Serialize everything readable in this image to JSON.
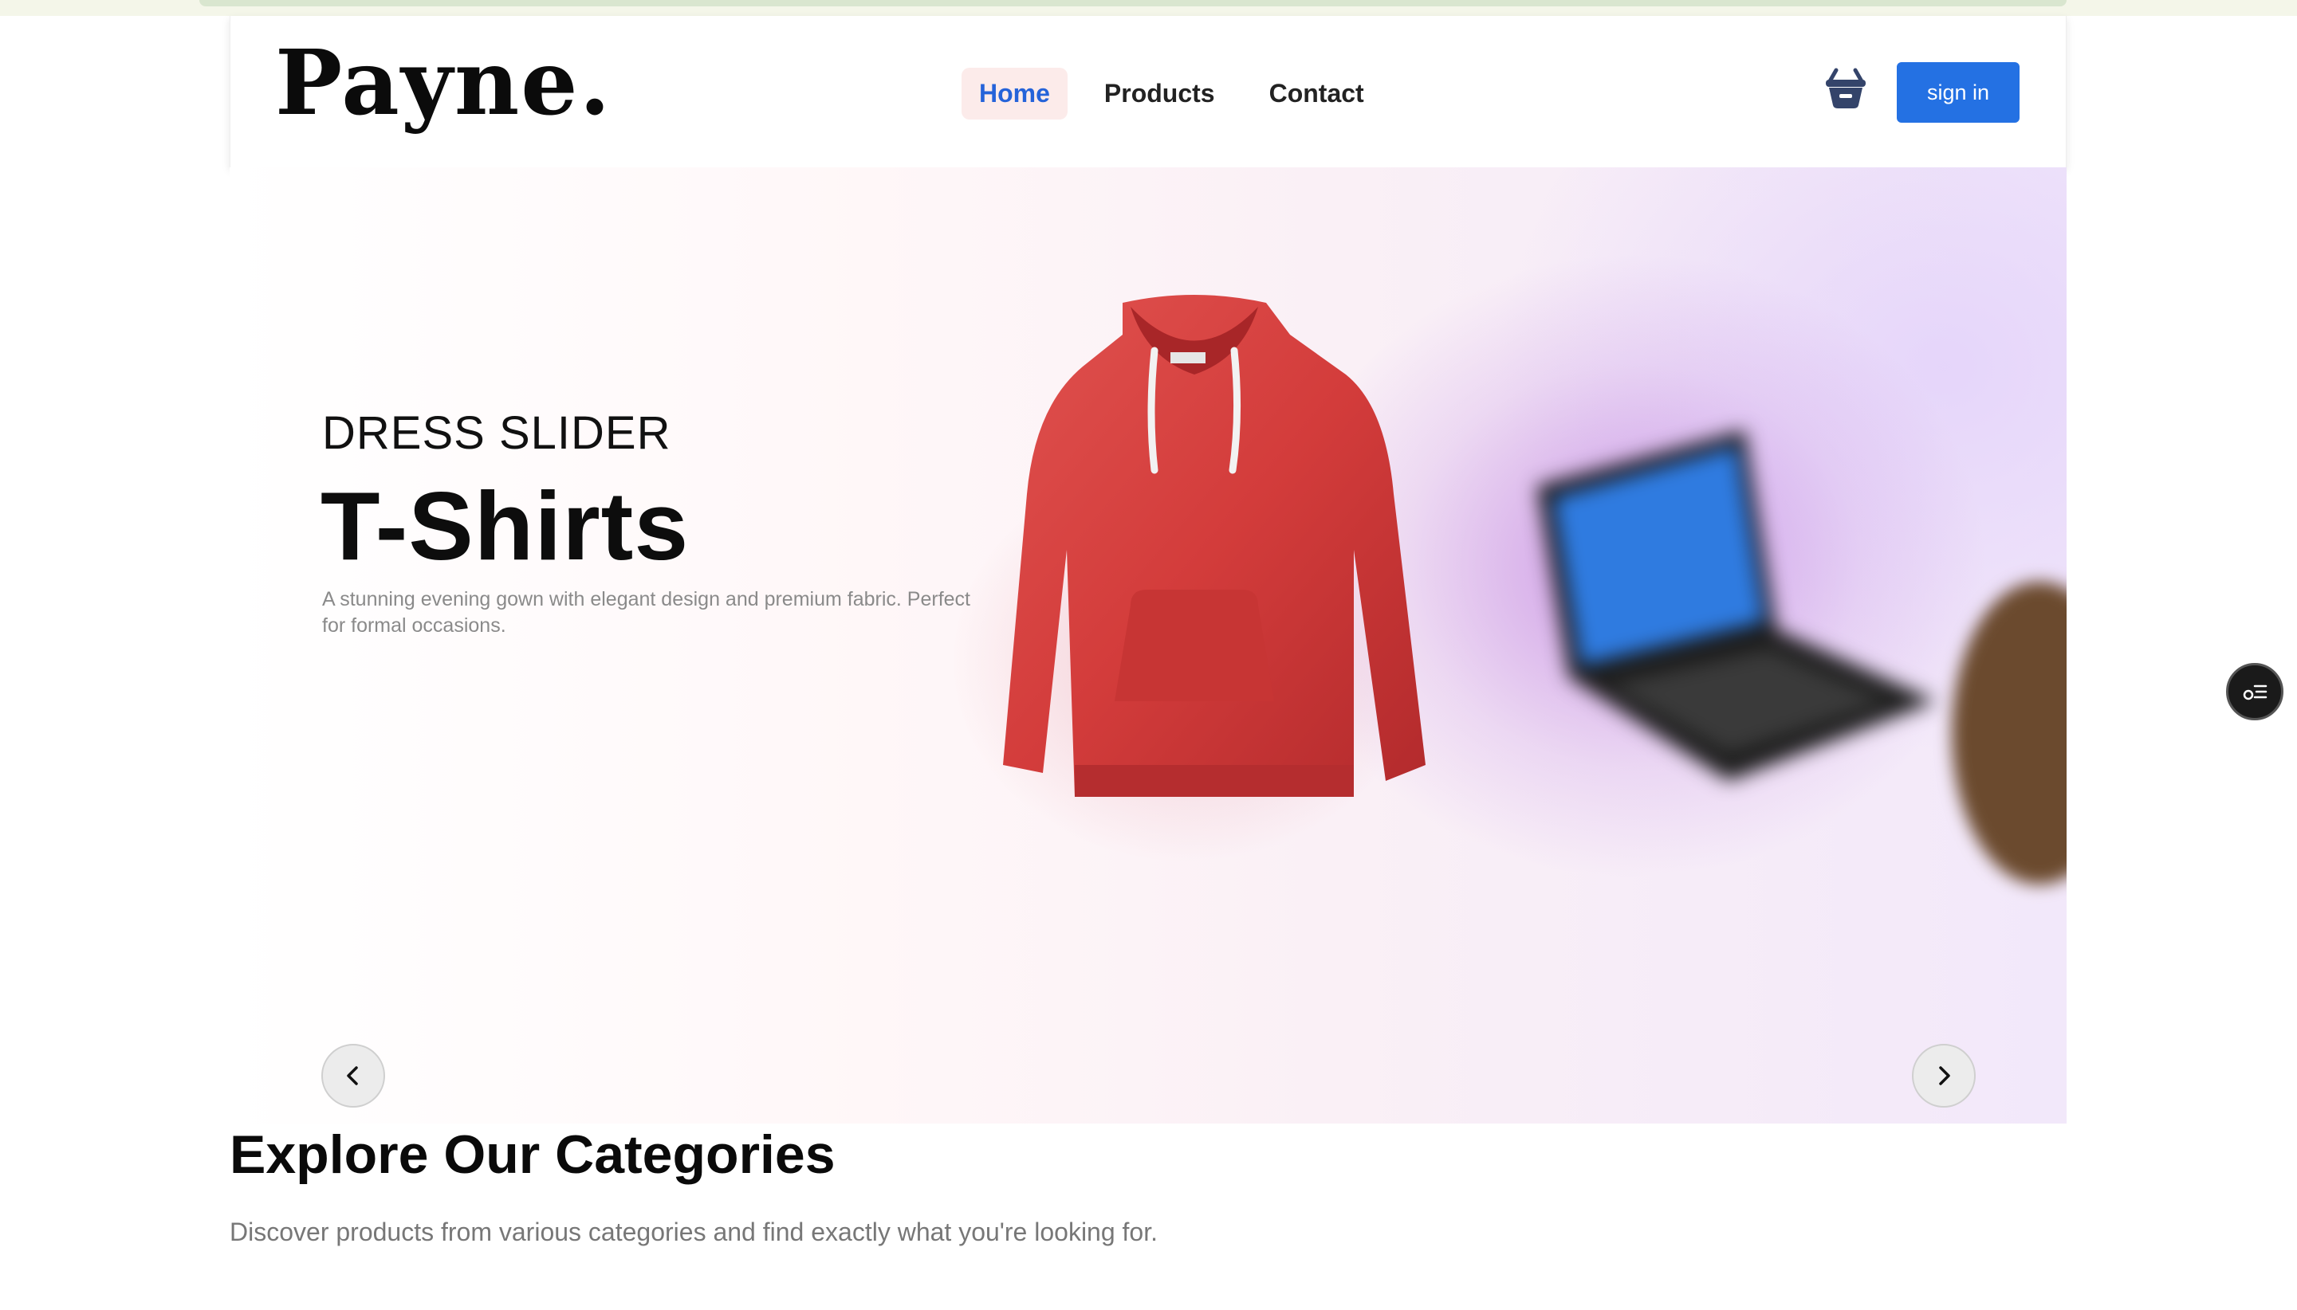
{
  "brand": {
    "logo_text": "Payne."
  },
  "nav": {
    "items": [
      {
        "label": "Home",
        "active": true
      },
      {
        "label": "Products",
        "active": false
      },
      {
        "label": "Contact",
        "active": false
      }
    ]
  },
  "header": {
    "cart_icon": "shopping-basket-icon",
    "signin_label": "sign in",
    "signin_color": "#2471e3"
  },
  "hero": {
    "subtitle": "DRESS SLIDER",
    "title": "T-Shirts",
    "description": "A stunning evening gown with elegant design and premium fabric. Perfect for formal occasions.",
    "prev_icon": "chevron-left-icon",
    "next_icon": "chevron-right-icon"
  },
  "categories": {
    "title": "Explore Our Categories",
    "description": "Discover products from various categories and find exactly what you're looking for."
  },
  "colors": {
    "accent": "#2563d9",
    "nav_active_bg": "#fcebea",
    "hoodie": "#d9413f"
  }
}
